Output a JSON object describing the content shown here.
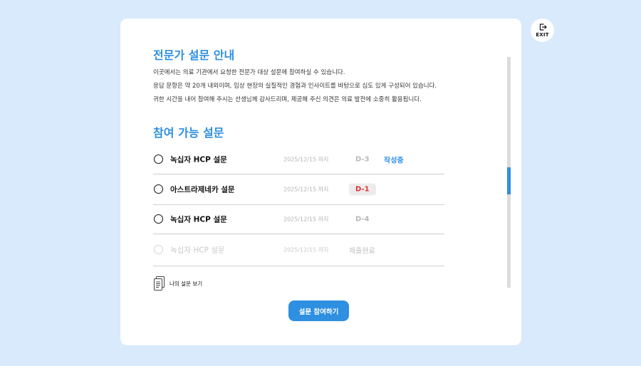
{
  "exit": {
    "label": "EXIT",
    "icon": "exit-icon"
  },
  "guide": {
    "title": "전문가 설문 안내",
    "lines": [
      "이곳에서는 의료 기관에서 요청한 전문가 대상 설문에 참여하실 수 있습니다.",
      "응답 문항은 약 20개 내외이며, 임상 현장의 실질적인 경험과 인사이트를 바탕으로 심도 있게 구성되어 있습니다.",
      "귀한 시간을 내어 참여해 주시는 선생님께 감사드리며, 제공해 주신 의견은 의료 발전에 소중히 활용됩니다."
    ]
  },
  "available": {
    "title": "참여 가능 설문",
    "surveys": [
      {
        "name": "녹십자 HCP 설문",
        "deadline": "2025/12/15 까지",
        "dday": "D-3",
        "status": "작성중"
      },
      {
        "name": "아스트라제네카 설문",
        "deadline": "2025/12/15 까지",
        "dday": "D-1",
        "status": ""
      },
      {
        "name": "녹십자 HCP 설문",
        "deadline": "2025/12/15 까지",
        "dday": "D-4",
        "status": ""
      },
      {
        "name": "녹십자 HCP 설문",
        "deadline": "2025/12/15 까지",
        "dday": "",
        "status": "제출완료"
      }
    ]
  },
  "my_surveys": {
    "label": "나의 설문 보기",
    "icon": "document-icon"
  },
  "join_button": {
    "label": "설문 참여하기"
  },
  "colors": {
    "background": "#d8eafb",
    "accent": "#2f8fe0",
    "urgent": "#e0322f",
    "card": "#ffffff"
  },
  "scroll": {
    "position_fraction": 0.48
  }
}
